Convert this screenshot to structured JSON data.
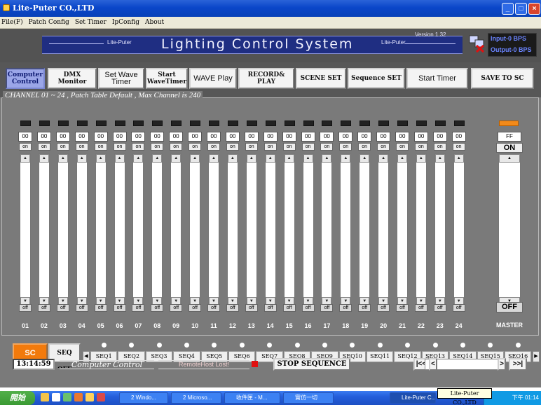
{
  "window": {
    "title": "Lite-Puter CO.,LTD",
    "controls": {
      "minimize": "_",
      "maximize": "□",
      "close": "×"
    }
  },
  "menu": [
    "File(F)",
    "Patch Config",
    "Set Timer",
    "IpConfig",
    "About"
  ],
  "banner": {
    "title": "Lighting Control System",
    "brand_left": "Lite-Puter",
    "brand_right": "Lite-Puter",
    "version": "Version 1.32",
    "input_bps": "Input-0 BPS",
    "output_bps": "Output-0 BPS",
    "io_icon": "network-disconnected-icon"
  },
  "toolbar": {
    "buttons": [
      {
        "label": "Computer Control",
        "active": true
      },
      {
        "label": "DMX Monitor"
      },
      {
        "label": "Set Wave Timer"
      },
      {
        "label": "Start WaveTimer"
      },
      {
        "label": "WAVE Play"
      },
      {
        "label": "RECORD& PLAY"
      },
      {
        "label": "SCENE SET"
      },
      {
        "label": "Sequence SET"
      },
      {
        "label": "Start Timer"
      },
      {
        "label": "SAVE TO SC"
      }
    ]
  },
  "panel": {
    "title": "CHANNEL 01 ~ 24 ,  Patch Table Default ,  Max Channel is 240",
    "channels": [
      {
        "num": "01",
        "value": "00",
        "on": "on",
        "off": "off"
      },
      {
        "num": "02",
        "value": "00",
        "on": "on",
        "off": "off"
      },
      {
        "num": "03",
        "value": "00",
        "on": "on",
        "off": "off"
      },
      {
        "num": "04",
        "value": "00",
        "on": "on",
        "off": "off"
      },
      {
        "num": "05",
        "value": "00",
        "on": "on",
        "off": "off"
      },
      {
        "num": "06",
        "value": "00",
        "on": "on",
        "off": "off"
      },
      {
        "num": "07",
        "value": "00",
        "on": "on",
        "off": "off"
      },
      {
        "num": "08",
        "value": "00",
        "on": "on",
        "off": "off"
      },
      {
        "num": "09",
        "value": "00",
        "on": "on",
        "off": "off"
      },
      {
        "num": "10",
        "value": "00",
        "on": "on",
        "off": "off"
      },
      {
        "num": "11",
        "value": "00",
        "on": "on",
        "off": "off"
      },
      {
        "num": "12",
        "value": "00",
        "on": "on",
        "off": "off"
      },
      {
        "num": "13",
        "value": "00",
        "on": "on",
        "off": "off"
      },
      {
        "num": "14",
        "value": "00",
        "on": "on",
        "off": "off"
      },
      {
        "num": "15",
        "value": "00",
        "on": "on",
        "off": "off"
      },
      {
        "num": "16",
        "value": "00",
        "on": "on",
        "off": "off"
      },
      {
        "num": "17",
        "value": "00",
        "on": "on",
        "off": "off"
      },
      {
        "num": "18",
        "value": "00",
        "on": "on",
        "off": "off"
      },
      {
        "num": "19",
        "value": "00",
        "on": "on",
        "off": "off"
      },
      {
        "num": "20",
        "value": "00",
        "on": "on",
        "off": "off"
      },
      {
        "num": "21",
        "value": "00",
        "on": "on",
        "off": "off"
      },
      {
        "num": "22",
        "value": "00",
        "on": "on",
        "off": "off"
      },
      {
        "num": "23",
        "value": "00",
        "on": "on",
        "off": "off"
      },
      {
        "num": "24",
        "value": "00",
        "on": "on",
        "off": "off"
      }
    ],
    "master": {
      "label": "MASTER",
      "value": "FF",
      "on": "ON",
      "off": "OFF",
      "indicator_color": "#f28a1a"
    }
  },
  "sequence": {
    "sc_panel": "SC Panel",
    "seq_off": "SEQ OFF",
    "items": [
      "SEQ1",
      "SEQ2",
      "SEQ3",
      "SEQ4",
      "SEQ5",
      "SEQ6",
      "SEQ7",
      "SEQ8",
      "SEQ9",
      "SEQ10",
      "SEQ11",
      "SEQ12",
      "SEQ13",
      "SEQ14",
      "SEQ15",
      "SEQ16"
    ]
  },
  "status": {
    "time": "13:14:59",
    "mode": "Computer Control",
    "remote": "RemoteHost Lost!",
    "stop_sequence": "STOP SEQUENCE",
    "nav_first": "|<<",
    "nav_prev": "<",
    "nav_next": ">",
    "nav_last": ">>|",
    "tooltip": "Lite-Puter CO.,LTD"
  },
  "taskbar": {
    "start": "開始",
    "tasks": [
      "2 Windo...",
      "2 Microso...",
      "收件匣 - M...",
      "實仿一切",
      "Lite-Puter C..."
    ],
    "clock": "下午 01:14"
  },
  "colors": {
    "accent_blue": "#1f2e82",
    "sc_orange": "#f27a0c",
    "remote_led": "#e01010",
    "panel_gray": "#7a7a7a"
  }
}
